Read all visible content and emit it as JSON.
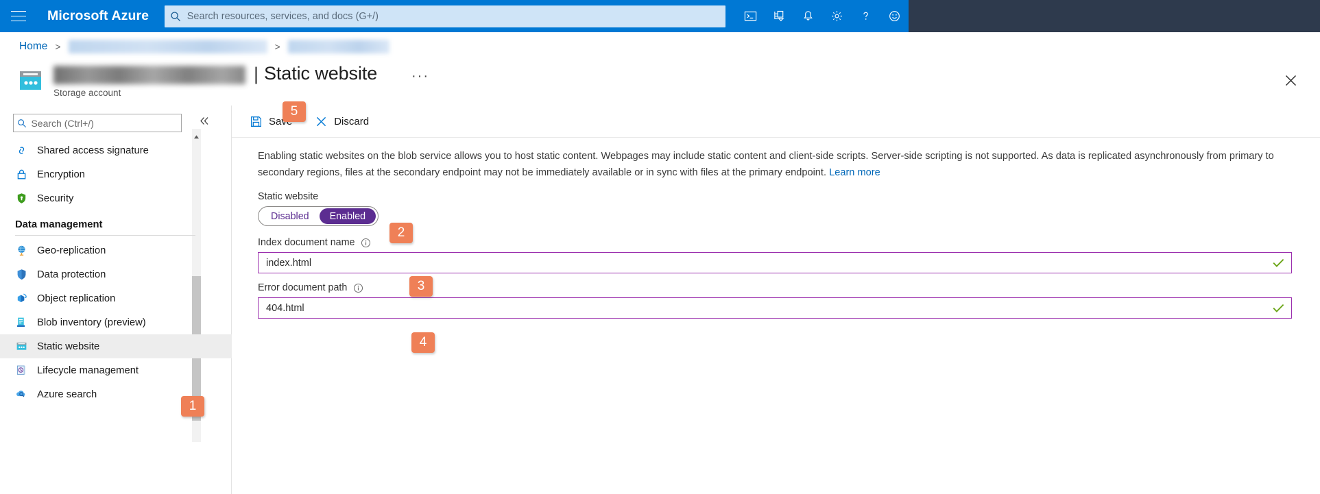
{
  "topbar": {
    "menu_icon": "hamburger-icon",
    "brand": "Microsoft Azure",
    "search_placeholder": "Search resources, services, and docs (G+/)",
    "search_value": "",
    "icons": [
      {
        "name": "cloud-shell-icon",
        "title": "Cloud Shell"
      },
      {
        "name": "directories-subscriptions-icon",
        "title": "Directories + subscriptions"
      },
      {
        "name": "notifications-bell-icon",
        "title": "Notifications"
      },
      {
        "name": "settings-gear-icon",
        "title": "Settings"
      },
      {
        "name": "help-question-icon",
        "title": "Help"
      },
      {
        "name": "feedback-smiley-icon",
        "title": "Feedback"
      }
    ]
  },
  "breadcrumb": {
    "home": "Home",
    "separator": ">",
    "item2": "",
    "item3": ""
  },
  "title": {
    "resource_name": "",
    "separator": "|",
    "page": "Static website",
    "ellipsis": "···",
    "subtitle": "Storage account",
    "close_icon": "close-icon"
  },
  "sidebar": {
    "search_placeholder": "Search (Ctrl+/)",
    "search_value": "",
    "collapse_icon": "chevron-double-left-icon",
    "items": [
      {
        "label": "Shared access signature",
        "icon": "link-icon",
        "selected": false
      },
      {
        "label": "Encryption",
        "icon": "lock-icon",
        "selected": false
      },
      {
        "label": "Security",
        "icon": "shield-green-icon",
        "selected": false
      }
    ],
    "section_label": "Data management",
    "data_items": [
      {
        "label": "Geo-replication",
        "icon": "globe-icon",
        "selected": false
      },
      {
        "label": "Data protection",
        "icon": "shield-blue-icon",
        "selected": false
      },
      {
        "label": "Object replication",
        "icon": "cube-icon",
        "selected": false
      },
      {
        "label": "Blob inventory (preview)",
        "icon": "inventory-list-icon",
        "selected": false
      },
      {
        "label": "Static website",
        "icon": "static-website-icon",
        "selected": true
      },
      {
        "label": "Lifecycle management",
        "icon": "clock-document-icon",
        "selected": false
      },
      {
        "label": "Azure search",
        "icon": "search-cloud-icon",
        "selected": false
      }
    ]
  },
  "commandbar": {
    "save_label": "Save",
    "save_icon": "save-floppy-icon",
    "discard_label": "Discard",
    "discard_icon": "discard-x-icon"
  },
  "main": {
    "description": "Enabling static websites on the blob service allows you to host static content. Webpages may include static content and client-side scripts. Server-side scripting is not supported. As data is replicated asynchronously from primary to secondary regions, files at the secondary endpoint may not be immediately available or in sync with files at the primary endpoint. ",
    "learn_more": "Learn more",
    "static_website_label": "Static website",
    "toggle": {
      "disabled_label": "Disabled",
      "enabled_label": "Enabled",
      "selected": "Enabled"
    },
    "index_label": "Index document name",
    "index_value": "index.html",
    "index_valid": true,
    "error_label": "Error document path",
    "error_value": "404.html",
    "error_valid": true,
    "info_icon": "info-circle-icon",
    "valid_icon": "checkmark-icon"
  },
  "annotations": [
    {
      "id": "1",
      "label": "1",
      "target": "sidebar-item-static-website"
    },
    {
      "id": "2",
      "label": "2",
      "target": "static-website-toggle"
    },
    {
      "id": "3",
      "label": "3",
      "target": "index-document-input"
    },
    {
      "id": "4",
      "label": "4",
      "target": "error-document-input"
    },
    {
      "id": "5",
      "label": "5",
      "target": "save-button"
    }
  ],
  "colors": {
    "azure_blue": "#0078d4",
    "accent_purple": "#5c2d91",
    "field_border_purple": "#9b2fae",
    "badge_orange": "#ef8057",
    "valid_green": "#6aa516",
    "link_blue": "#0067b8"
  }
}
